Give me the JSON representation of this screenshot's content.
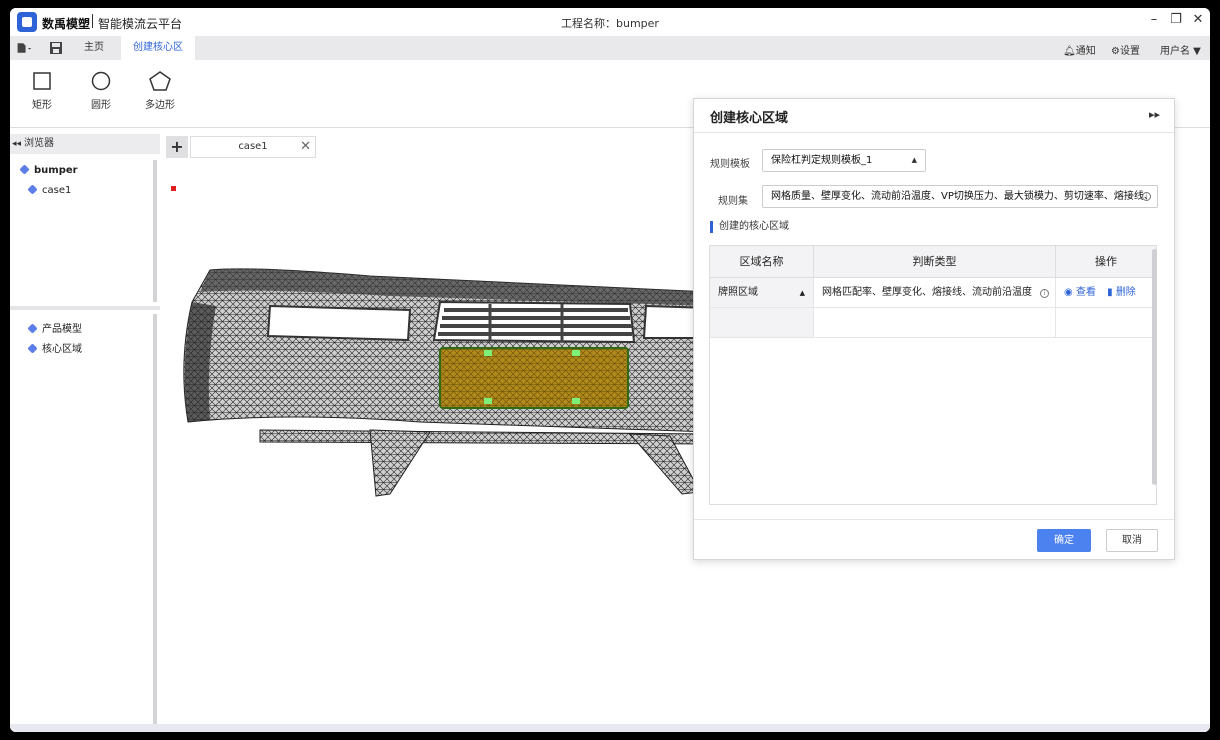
{
  "app": {
    "brand": "数禹模塑",
    "subbrand": "智能模流云平台",
    "project_title": "工程名称：bumper"
  },
  "window_controls": {
    "minimize": "–",
    "restore": "❐",
    "close": "✕"
  },
  "menubar": {
    "tabs": [
      {
        "label": "主页"
      },
      {
        "label": "创建核心区"
      }
    ],
    "right": {
      "notify": "通知",
      "settings": "设置",
      "user": "用户名 ▼"
    }
  },
  "ribbon": {
    "tools": [
      {
        "label": "矩形",
        "icon": "square-icon"
      },
      {
        "label": "圆形",
        "icon": "circle-icon"
      },
      {
        "label": "多边形",
        "icon": "pentagon-icon"
      }
    ]
  },
  "browser": {
    "header": "浏览器",
    "collapse": "◂◂",
    "tree": [
      {
        "label": "bumper",
        "bold": true
      },
      {
        "label": "case1"
      }
    ],
    "lower_tree": [
      {
        "label": "产品模型"
      },
      {
        "label": "核心区域"
      }
    ]
  },
  "viewport": {
    "tab_label": "case1",
    "add_label": "+",
    "close_label": "✕"
  },
  "dialog": {
    "title": "创建核心区域",
    "collapse": "▸▸",
    "rule_template_label": "规则模板",
    "rule_template_value": "保险杠判定规则模板_1",
    "rule_set_label": "规则集",
    "rule_set_value": "网格质量、壁厚变化、流动前沿温度、VP切换压力、最大锁模力、剪切速率、熔接线、",
    "section_label": "创建的核心区域",
    "table": {
      "headers": [
        "区域名称",
        "判断类型",
        "操作"
      ],
      "rows": [
        {
          "name": "牌照区域",
          "type": "网格匹配率、壁厚变化、熔接线、流动前沿温度",
          "view": "查看",
          "delete": "删除"
        }
      ]
    },
    "confirm": "确定",
    "cancel": "取消"
  }
}
